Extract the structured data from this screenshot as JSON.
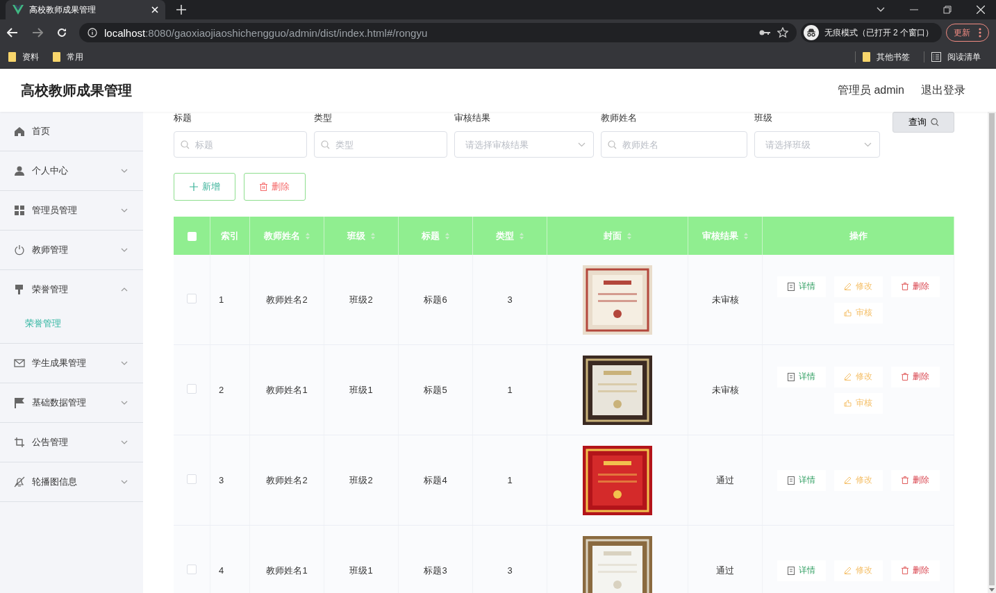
{
  "browser": {
    "tab_title": "高校教师成果管理",
    "url_host": "localhost",
    "url_path": ":8080/gaoxiaojiaoshichengguo/admin/dist/index.html#/rongyu",
    "profile": "无痕模式（已打开 2 个窗口）",
    "update_button": "更新",
    "bookmarks": [
      {
        "label": "资料",
        "kind": "folder"
      },
      {
        "label": "常用",
        "kind": "folder"
      }
    ],
    "bookmarks_right": [
      {
        "label": "其他书签",
        "kind": "folder"
      },
      {
        "label": "阅读清单",
        "kind": "list"
      }
    ]
  },
  "header": {
    "title": "高校教师成果管理",
    "user": "管理员 admin",
    "logout": "退出登录"
  },
  "sidebar": {
    "items": [
      {
        "label": "首页",
        "kind": "link"
      },
      {
        "label": "个人中心",
        "kind": "menu",
        "expanded": false
      },
      {
        "label": "管理员管理",
        "kind": "menu",
        "expanded": false
      },
      {
        "label": "教师管理",
        "kind": "menu",
        "expanded": false
      },
      {
        "label": "荣誉管理",
        "kind": "menu",
        "expanded": true,
        "children": [
          {
            "label": "荣誉管理",
            "selected": true
          }
        ]
      },
      {
        "label": "学生成果管理",
        "kind": "menu",
        "expanded": false
      },
      {
        "label": "基础数据管理",
        "kind": "menu",
        "expanded": false
      },
      {
        "label": "公告管理",
        "kind": "menu",
        "expanded": false
      },
      {
        "label": "轮播图信息",
        "kind": "menu",
        "expanded": false
      }
    ]
  },
  "filters": [
    {
      "label": "标题",
      "kind": "search",
      "placeholder": "标题"
    },
    {
      "label": "类型",
      "kind": "search",
      "placeholder": "类型"
    },
    {
      "label": "审核结果",
      "kind": "select",
      "placeholder": "请选择审核结果"
    },
    {
      "label": "教师姓名",
      "kind": "search",
      "placeholder": "教师姓名"
    },
    {
      "label": "班级",
      "kind": "select",
      "placeholder": "请选择班级"
    }
  ],
  "query_button": "查询",
  "toolbar": [
    {
      "label": "新增",
      "kind": "add"
    },
    {
      "label": "删除",
      "kind": "delete"
    }
  ],
  "table": {
    "all_checked": false,
    "columns": [
      "索引",
      "教师姓名",
      "班级",
      "标题",
      "类型",
      "封面",
      "审核结果",
      "操作"
    ],
    "rows": [
      {
        "checked": false,
        "cells": [
          "1",
          "教师姓名2",
          "班级2",
          "标题6",
          "3"
        ],
        "cover": {
          "kind": "picture"
        },
        "status": "未审核",
        "actions": [
          {
            "label": "详情",
            "kind": "detail"
          },
          {
            "label": "修改",
            "kind": "edit"
          },
          {
            "label": "删除",
            "kind": "delete"
          },
          {
            "label": "审核",
            "kind": "review"
          }
        ]
      },
      {
        "checked": false,
        "cells": [
          "2",
          "教师姓名1",
          "班级1",
          "标题5",
          "1"
        ],
        "cover": {
          "kind": "picture"
        },
        "status": "未审核",
        "actions": [
          {
            "label": "详情",
            "kind": "detail"
          },
          {
            "label": "修改",
            "kind": "edit"
          },
          {
            "label": "删除",
            "kind": "delete"
          },
          {
            "label": "审核",
            "kind": "review"
          }
        ]
      },
      {
        "checked": false,
        "cells": [
          "3",
          "教师姓名2",
          "班级2",
          "标题4",
          "1"
        ],
        "cover": {
          "kind": "picture"
        },
        "status": "通过",
        "actions": [
          {
            "label": "详情",
            "kind": "detail"
          },
          {
            "label": "修改",
            "kind": "edit"
          },
          {
            "label": "删除",
            "kind": "delete"
          }
        ]
      },
      {
        "checked": false,
        "cells": [
          "4",
          "教师姓名1",
          "班级1",
          "标题3",
          "3"
        ],
        "cover": {
          "kind": "picture"
        },
        "status": "通过",
        "actions": [
          {
            "label": "详情",
            "kind": "detail"
          },
          {
            "label": "修改",
            "kind": "edit"
          },
          {
            "label": "删除",
            "kind": "delete"
          }
        ]
      }
    ]
  }
}
